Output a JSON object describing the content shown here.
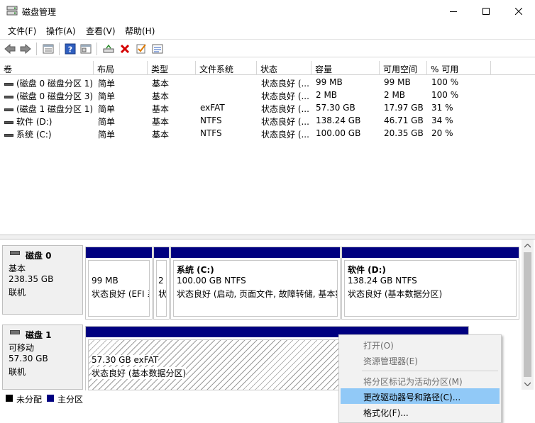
{
  "window": {
    "title": "磁盘管理"
  },
  "menu": [
    "文件(F)",
    "操作(A)",
    "查看(V)",
    "帮助(H)"
  ],
  "toolbar": {
    "icons": [
      "back-icon",
      "forward-icon",
      "properties-icon",
      "help-icon",
      "view-icon",
      "connect-icon",
      "delete-icon",
      "check-icon",
      "list-icon"
    ]
  },
  "volumes": {
    "columns": [
      "卷",
      "布局",
      "类型",
      "文件系统",
      "状态",
      "容量",
      "可用空间",
      "% 可用"
    ],
    "rows": [
      [
        "(磁盘 0 磁盘分区 1)",
        "简单",
        "基本",
        "",
        "状态良好 (...",
        "99 MB",
        "99 MB",
        "100 %"
      ],
      [
        "(磁盘 0 磁盘分区 3)",
        "简单",
        "基本",
        "",
        "状态良好 (...",
        "2 MB",
        "2 MB",
        "100 %"
      ],
      [
        "(磁盘 1 磁盘分区 1)",
        "简单",
        "基本",
        "exFAT",
        "状态良好 (...",
        "57.30 GB",
        "17.97 GB",
        "31 %"
      ],
      [
        "软件 (D:)",
        "简单",
        "基本",
        "NTFS",
        "状态良好 (...",
        "138.24 GB",
        "46.71 GB",
        "34 %"
      ],
      [
        "系统 (C:)",
        "简单",
        "基本",
        "NTFS",
        "状态良好 (...",
        "100.00 GB",
        "20.35 GB",
        "20 %"
      ]
    ]
  },
  "disks": [
    {
      "name": "磁盘 0",
      "type": "基本",
      "size": "238.35 GB",
      "status": "联机",
      "partitions": [
        {
          "title": "",
          "size": "99 MB",
          "status": "状态良好 (EFI 系统分区)"
        },
        {
          "title": "",
          "size": "2",
          "status": "状态良好"
        },
        {
          "title": "系统  (C:)",
          "size": "100.00 GB NTFS",
          "status": "状态良好 (启动, 页面文件, 故障转储, 基本数据分区)"
        },
        {
          "title": "软件  (D:)",
          "size": "138.24 GB NTFS",
          "status": "状态良好 (基本数据分区)"
        }
      ]
    },
    {
      "name": "磁盘 1",
      "type": "可移动",
      "size": "57.30 GB",
      "status": "联机",
      "partitions": [
        {
          "title": "",
          "size": "57.30 GB exFAT",
          "status": "状态良好 (基本数据分区)"
        }
      ]
    }
  ],
  "legend": [
    {
      "label": "未分配",
      "color": "#000000"
    },
    {
      "label": "主分区",
      "color": "#000080"
    }
  ],
  "context_menu": {
    "items": [
      {
        "label": "打开(O)",
        "enabled": false
      },
      {
        "label": "资源管理器(E)",
        "enabled": false
      },
      {
        "label": "将分区标记为活动分区(M)",
        "enabled": false
      },
      {
        "label": "更改驱动器号和路径(C)...",
        "enabled": true,
        "highlighted": true
      },
      {
        "label": "格式化(F)...",
        "enabled": true
      }
    ]
  },
  "colors": {
    "primary_partition": "#000080",
    "highlight": "#91c9f7"
  }
}
